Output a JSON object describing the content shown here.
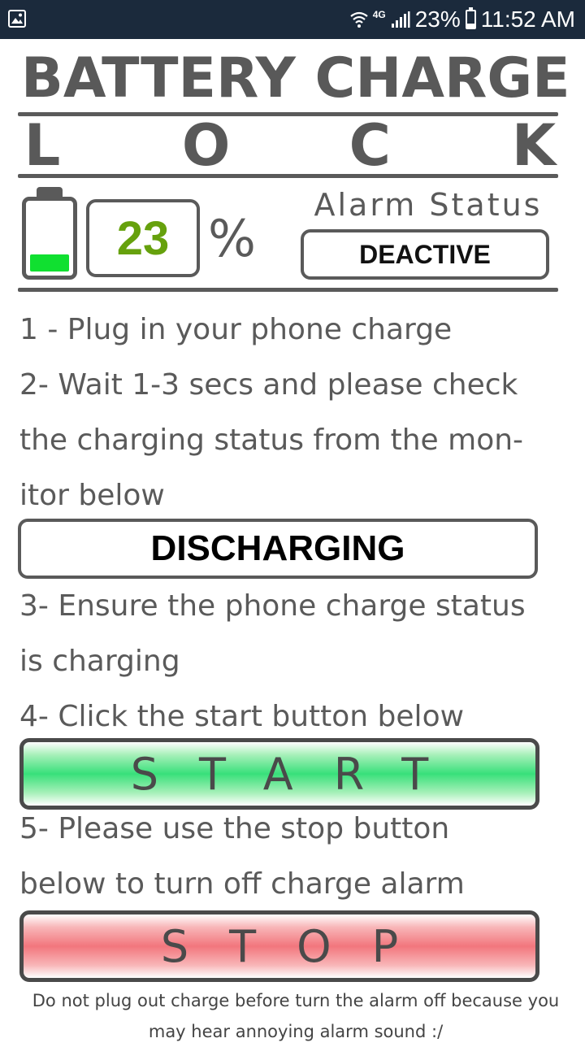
{
  "status_bar": {
    "left_icon": "image-icon",
    "network": "4G",
    "battery_percent": "23%",
    "battery_level": 0.23,
    "time": "11:52 AM"
  },
  "header": {
    "title_line1": "BATTERY CHARGE",
    "title_line2_letters": [
      "L",
      "O",
      "C",
      "K"
    ]
  },
  "battery": {
    "level_fraction": 0.23,
    "level_color": "#10e030",
    "percent_value": "23",
    "percent_sign": "%",
    "percent_color": "#66a10d"
  },
  "alarm": {
    "label": "Alarm Status",
    "value": "DEACTIVE"
  },
  "instructions": {
    "step1": "1 - Plug in your phone charge",
    "step2_line1": "2- Wait 1-3 secs and please check",
    "step2_line2": "the   charging status from the mon-",
    "step2_line3": "itor below",
    "step3_line1": "3- Ensure the phone charge status",
    "step3_line2": "is charging",
    "step4": "4- Click the start button below",
    "step5_line1": "5- Please use the stop button",
    "step5_line2": "below to turn off charge alarm"
  },
  "charge_status": "DISCHARGING",
  "buttons": {
    "start_label": "START",
    "stop_label": "STOP"
  },
  "footer": {
    "note": "Do not plug out charge before turn the alarm off because you may hear annoying alarm sound :/"
  }
}
